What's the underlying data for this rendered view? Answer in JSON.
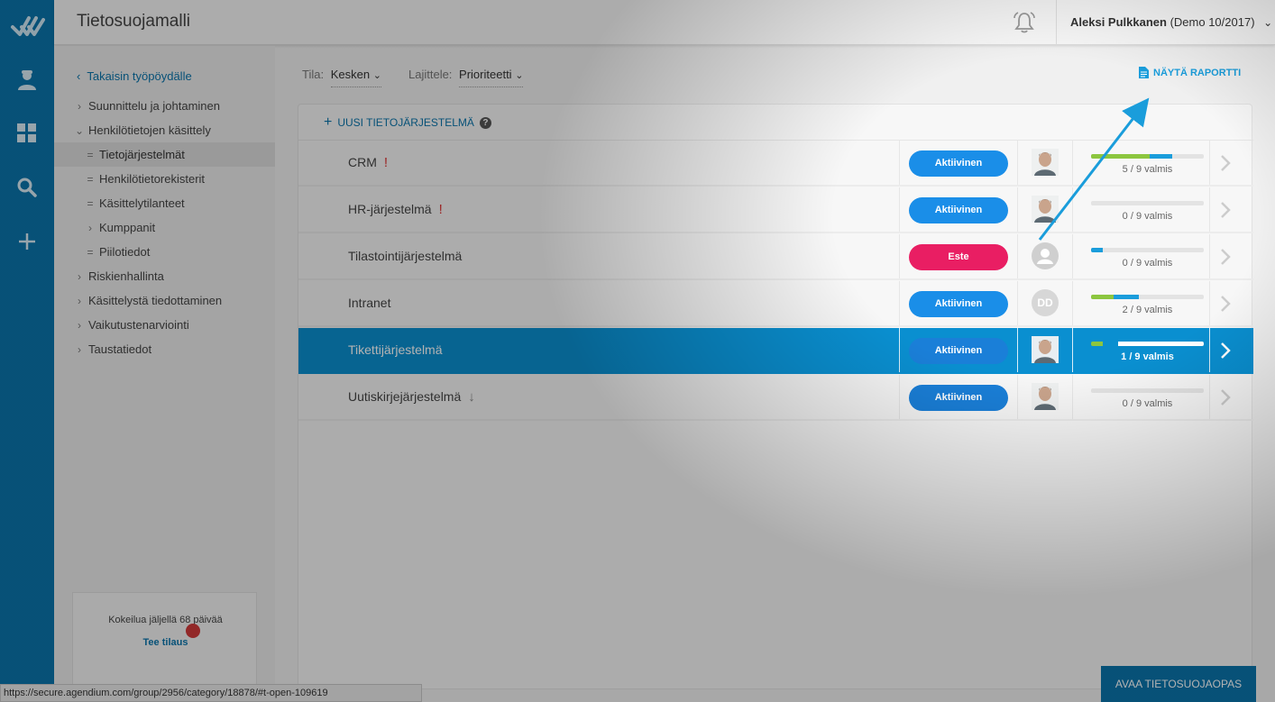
{
  "app": {
    "title": "Tietosuojamalli"
  },
  "user": {
    "name": "Aleksi Pulkkanen",
    "org": "(Demo 10/2017)"
  },
  "sidebar": {
    "back_label": "Takaisin työpöydälle",
    "items": [
      {
        "label": "Suunnittelu ja johtaminen",
        "marker": "›",
        "indent": 0
      },
      {
        "label": "Henkilötietojen käsittely",
        "marker": "⌄",
        "indent": 0
      },
      {
        "label": "Tietojärjestelmät",
        "marker": "=",
        "indent": 1,
        "active": true
      },
      {
        "label": "Henkilötietorekisterit",
        "marker": "=",
        "indent": 1
      },
      {
        "label": "Käsittelytilanteet",
        "marker": "=",
        "indent": 1
      },
      {
        "label": "Kumppanit",
        "marker": "›",
        "indent": 1
      },
      {
        "label": "Piilotiedot",
        "marker": "=",
        "indent": 1
      },
      {
        "label": "Riskienhallinta",
        "marker": "›",
        "indent": 0
      },
      {
        "label": "Käsittelystä tiedottaminen",
        "marker": "›",
        "indent": 0
      },
      {
        "label": "Vaikutustenarviointi",
        "marker": "›",
        "indent": 0
      },
      {
        "label": "Taustatiedot",
        "marker": "›",
        "indent": 0
      }
    ]
  },
  "trial": {
    "text": "Kokeilua jäljellä 68 päivää",
    "link": "Tee tilaus"
  },
  "filters": {
    "status_label": "Tila:",
    "status_value": "Kesken",
    "sort_label": "Lajittele:",
    "sort_value": "Prioriteetti"
  },
  "report": {
    "label": "NÄYTÄ RAPORTTI"
  },
  "add": {
    "label": "UUSI TIETOJÄRJESTELMÄ",
    "help": "?"
  },
  "rows": [
    {
      "name": "CRM",
      "flag": "!",
      "status": "Aktiivinen",
      "status_color": "#1a8ee8",
      "avatar": "photo",
      "progress_text": "5 / 9 valmis",
      "green": 0.52,
      "blue": 0.2
    },
    {
      "name": "HR-järjestelmä",
      "flag": "!",
      "status": "Aktiivinen",
      "status_color": "#1a8ee8",
      "avatar": "photo",
      "progress_text": "0 / 9 valmis",
      "green": 0,
      "blue": 0
    },
    {
      "name": "Tilastointijärjestelmä",
      "flag": "",
      "status": "Este",
      "status_color": "#e91e63",
      "avatar": "placeholder",
      "progress_text": "0 / 9 valmis",
      "green": 0,
      "blue": 0.1
    },
    {
      "name": "Intranet",
      "flag": "",
      "status": "Aktiivinen",
      "status_color": "#1a8ee8",
      "avatar": "DD",
      "progress_text": "2 / 9 valmis",
      "green": 0.2,
      "blue": 0.22
    },
    {
      "name": "Tikettijärjestelmä",
      "flag": "",
      "status": "Aktiivinen",
      "status_color": "#1a7fd8",
      "avatar": "photo",
      "progress_text": "1 / 9 valmis",
      "green": 0.1,
      "blue": 0,
      "selected": true
    },
    {
      "name": "Uutiskirjejärjestelmä",
      "flag": "↓",
      "status": "Aktiivinen",
      "status_color": "#1a7fd8",
      "avatar": "photo",
      "progress_text": "0 / 9 valmis",
      "green": 0,
      "blue": 0
    }
  ],
  "statusbar": {
    "url": "https://secure.agendium.com/group/2956/category/18878/#t-open-109619"
  },
  "guide": {
    "label": "AVAA TIETOSUOJAOPAS"
  }
}
